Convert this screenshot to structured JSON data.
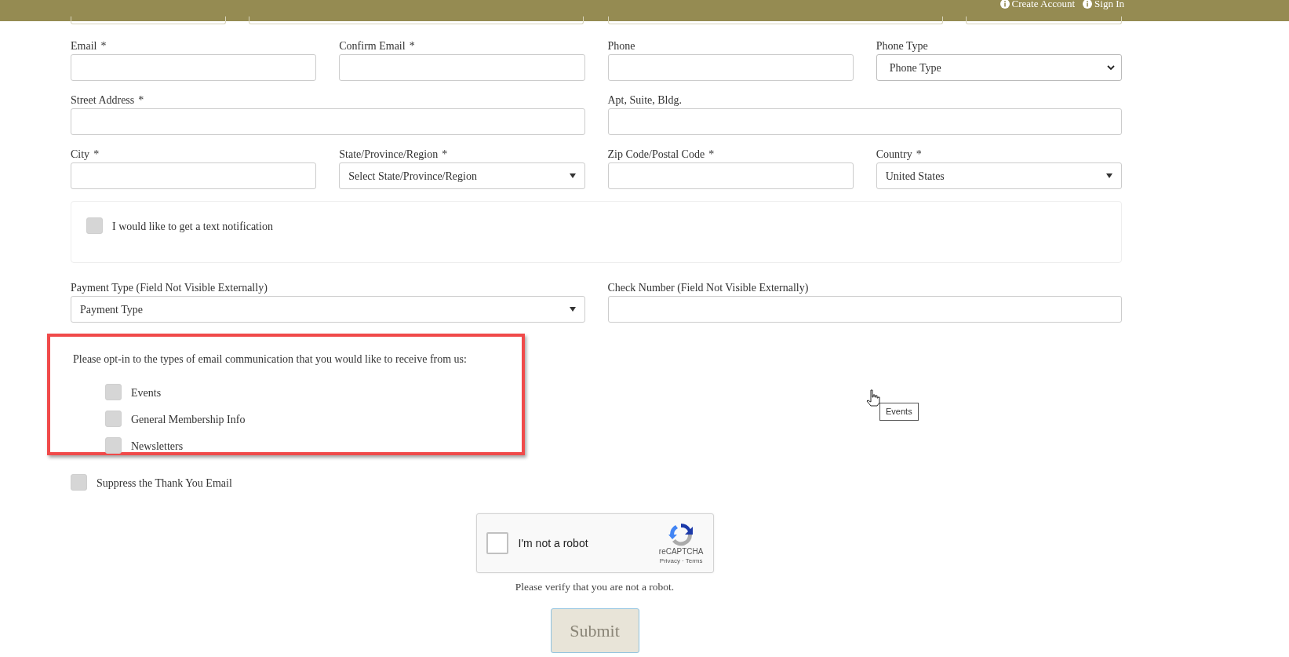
{
  "top_links": [
    {
      "label": "Create Account"
    },
    {
      "label": "Sign In"
    }
  ],
  "field_rows": [
    [
      {
        "label": "Email",
        "required_mark": "*",
        "kind": "text"
      },
      {
        "label": "Confirm Email",
        "required_mark": "*",
        "kind": "text"
      },
      {
        "label": "Phone",
        "kind": "text"
      },
      {
        "label": "Phone Type",
        "kind": "dropdown",
        "value": "Phone Type"
      }
    ],
    [
      {
        "label": "Street Address",
        "required_mark": "*",
        "kind": "text"
      },
      {
        "label": "Apt, Suite, Bldg.",
        "kind": "text"
      }
    ],
    [
      {
        "label": "City",
        "required_mark": "*",
        "kind": "text"
      },
      {
        "label": "State/Province/Region",
        "required_mark": "*",
        "kind": "select",
        "value": "Select State/Province/Region"
      },
      {
        "label": "Zip Code/Postal Code",
        "required_mark": "*",
        "kind": "text"
      },
      {
        "label": "Country",
        "required_mark": "*",
        "kind": "select",
        "value": "United States"
      }
    ]
  ],
  "text_notification": {
    "label": "I would like to get a text notification",
    "checked": false
  },
  "payment_row": [
    {
      "label": "Payment Type (Field Not Visible Externally)",
      "kind": "select",
      "value": "Payment Type"
    },
    {
      "label": "Check Number (Field Not Visible Externally)",
      "kind": "text"
    }
  ],
  "opt_in": {
    "highlighted": true,
    "prompt": "Please opt-in to the types of email communication that you would like to receive from us:",
    "options": [
      {
        "label": "Events",
        "checked": false
      },
      {
        "label": "General Membership Info",
        "checked": false
      },
      {
        "label": "Newsletters",
        "checked": false
      }
    ]
  },
  "suppress": {
    "label": "Suppress the Thank You Email",
    "checked": false
  },
  "captcha": {
    "label": "I'm not a robot",
    "checked": false,
    "brand": "reCAPTCHA",
    "links": [
      "Privacy",
      "Terms"
    ],
    "separator": "·"
  },
  "verify_message": "Please verify that you are not a robot.",
  "submit": {
    "label": "Submit",
    "disabled": true
  },
  "tooltip": {
    "text": "Events"
  }
}
